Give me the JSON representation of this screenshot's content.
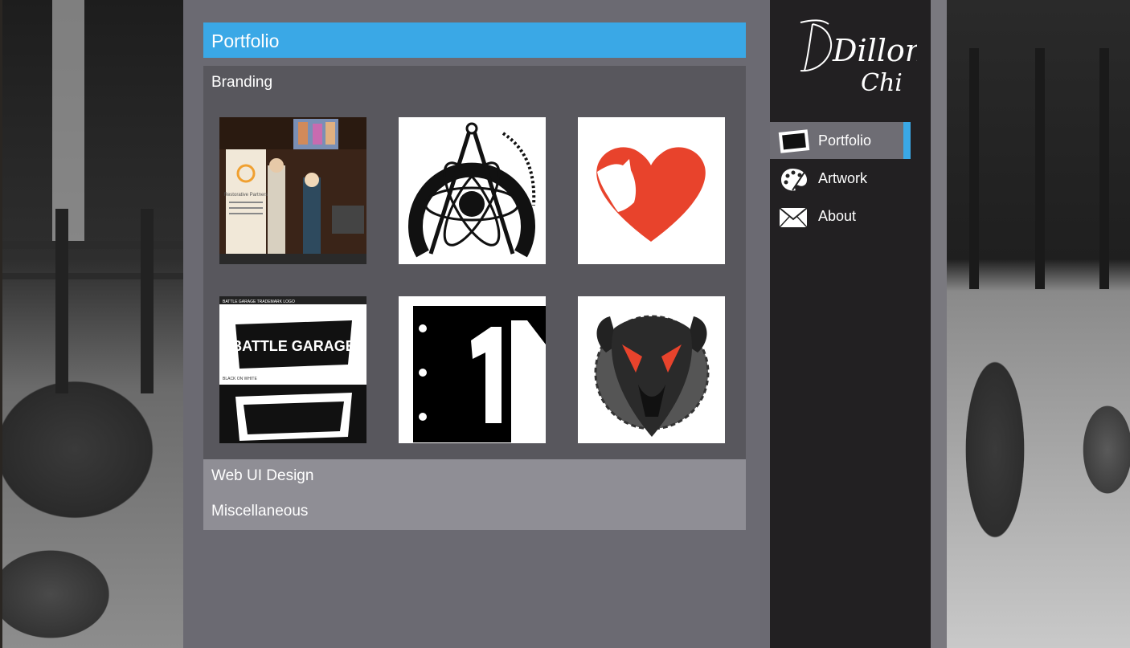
{
  "header": {
    "title": "Portfolio"
  },
  "sections": [
    {
      "label": "Branding",
      "expanded": true
    },
    {
      "label": "Web UI Design",
      "expanded": false
    },
    {
      "label": "Miscellaneous",
      "expanded": false
    }
  ],
  "thumbnails": [
    {
      "subject": "event-photo",
      "text": "Restorative Partners"
    },
    {
      "subject": "compass-atom-logo"
    },
    {
      "subject": "heart-horse-logo"
    },
    {
      "subject": "battle-garage-logo",
      "text_top": "BATTLE GARAGE TRADEMARK LOGO",
      "text_logo": "BATTLE GARAGE",
      "text_small": "BLACK ON WHITE"
    },
    {
      "subject": "one-m-logo"
    },
    {
      "subject": "rat-mascot-logo"
    }
  ],
  "sidebar": {
    "signature_line1": "Dillon",
    "signature_line2": "Chi",
    "nav": [
      {
        "label": "Portfolio",
        "icon": "photo-icon",
        "active": true
      },
      {
        "label": "Artwork",
        "icon": "palette-icon",
        "active": false
      },
      {
        "label": "About",
        "icon": "envelope-icon",
        "active": false
      }
    ]
  },
  "colors": {
    "accent": "#3aa8e6",
    "sidebar_bg": "#222022",
    "content_bg": "#6b6a72",
    "active_nav": "#6e6d74",
    "heart_red": "#e8432c"
  }
}
